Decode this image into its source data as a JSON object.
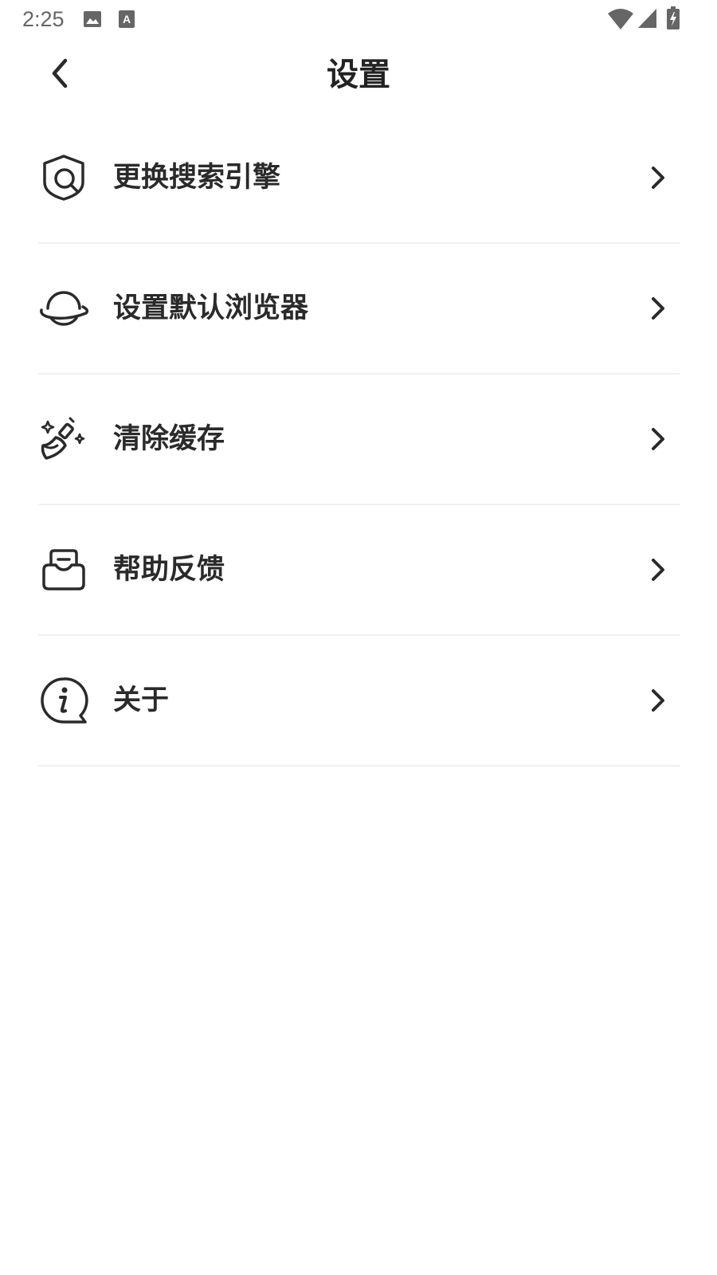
{
  "status_bar": {
    "time": "2:25",
    "icons": [
      "image-notification-icon",
      "text-notification-icon",
      "wifi-icon",
      "cellular-signal-icon",
      "battery-charging-icon"
    ]
  },
  "app_bar": {
    "title": "设置",
    "back_icon": "chevron-left-icon"
  },
  "menu": {
    "items": [
      {
        "label": "更换搜索引擎",
        "icon": "shield-search-icon"
      },
      {
        "label": "设置默认浏览器",
        "icon": "planet-icon"
      },
      {
        "label": "清除缓存",
        "icon": "broom-sparkle-icon"
      },
      {
        "label": "帮助反馈",
        "icon": "inbox-icon"
      },
      {
        "label": "关于",
        "icon": "info-bubble-icon"
      }
    ]
  },
  "colors": {
    "text": "#2a2a2a",
    "divider": "#f0f0f0",
    "status_gray": "#666666",
    "background": "#ffffff"
  }
}
